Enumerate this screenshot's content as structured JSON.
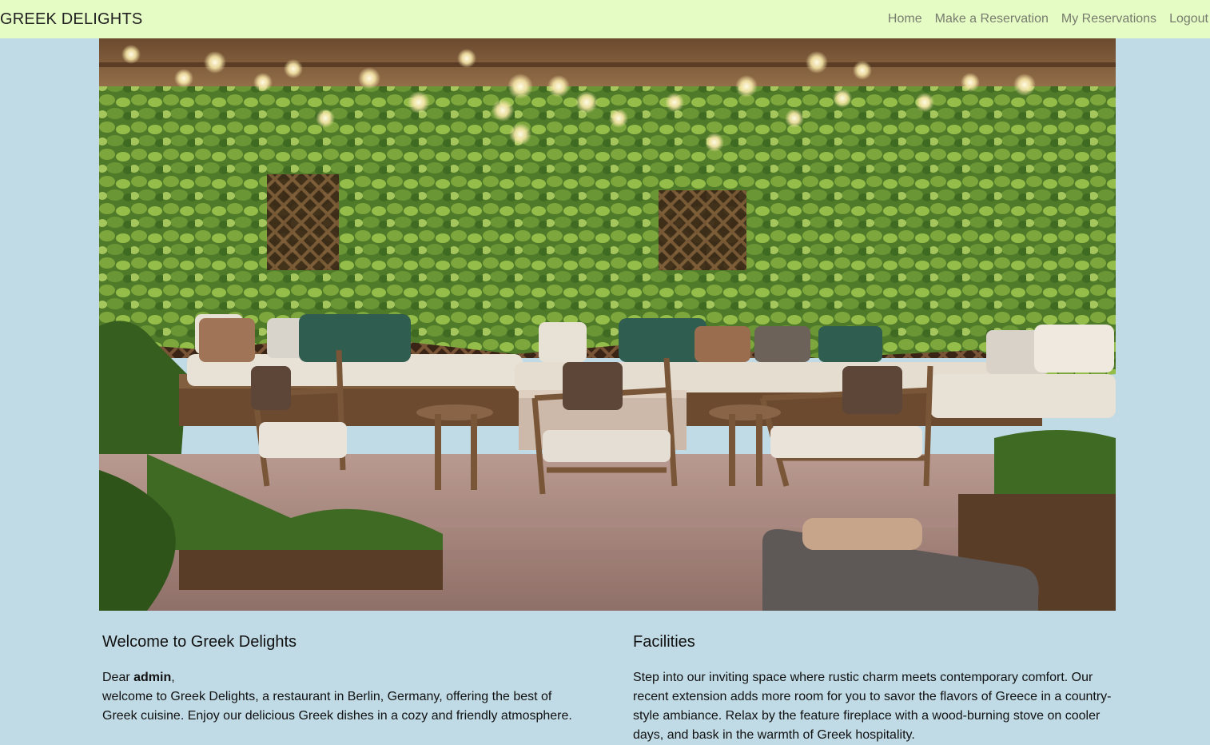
{
  "nav": {
    "brand": "GREEK DELIGHTS",
    "links": [
      {
        "label": "Home"
      },
      {
        "label": "Make a Reservation"
      },
      {
        "label": "My Reservations"
      },
      {
        "label": "Logout"
      }
    ]
  },
  "hero": {
    "image_subject": "outdoor-terrace-photo",
    "icon": "photo-icon"
  },
  "welcome": {
    "title": "Welcome to Greek Delights",
    "greeting_prefix": "Dear ",
    "username": "admin",
    "greeting_suffix": ",",
    "body": "welcome to Greek Delights, a restaurant in Berlin, Germany, offering the best of Greek cuisine. Enjoy our delicious Greek dishes in a cozy and friendly atmosphere."
  },
  "facilities": {
    "title": "Facilities",
    "body": "Step into our inviting space where rustic charm meets contemporary comfort. Our recent extension adds more room for you to savor the flavors of Greece in a country-style ambiance. Relax by the feature fireplace with a wood-burning stove on cooler days, and bask in the warmth of Greek hospitality."
  },
  "colors": {
    "navbar_bg": "#e6fcc5",
    "page_bg": "#c1dbe6",
    "nav_link": "#777c6e"
  }
}
